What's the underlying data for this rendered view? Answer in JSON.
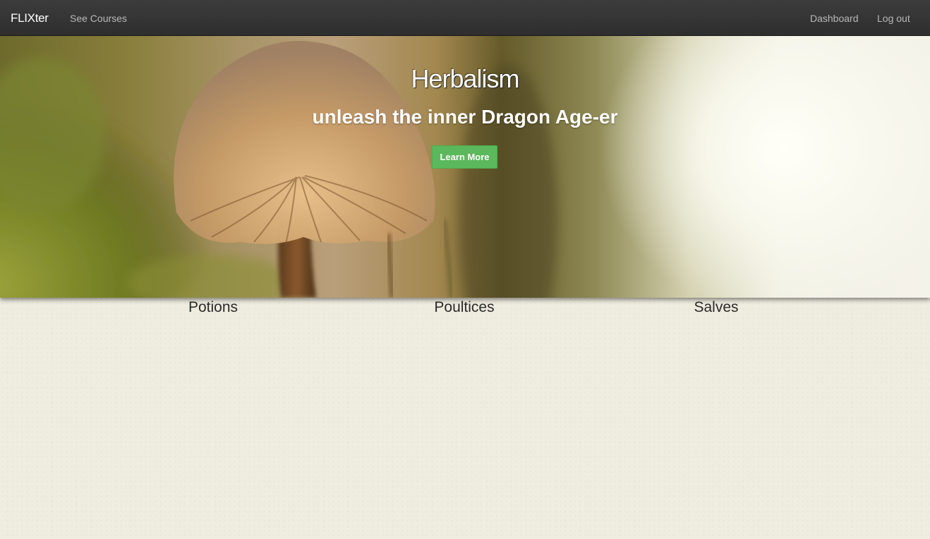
{
  "navbar": {
    "brand": "FLIXter",
    "links": [
      {
        "label": "See Courses"
      },
      {
        "label": "Dashboard"
      },
      {
        "label": "Log out"
      }
    ]
  },
  "hero": {
    "title": "Herbalism",
    "subtitle": "unleash the inner Dragon Age-er",
    "button_label": "Learn More",
    "button_color": "#5cb85c"
  },
  "categories": [
    {
      "label": "Potions"
    },
    {
      "label": "Poultices"
    },
    {
      "label": "Salves"
    }
  ]
}
